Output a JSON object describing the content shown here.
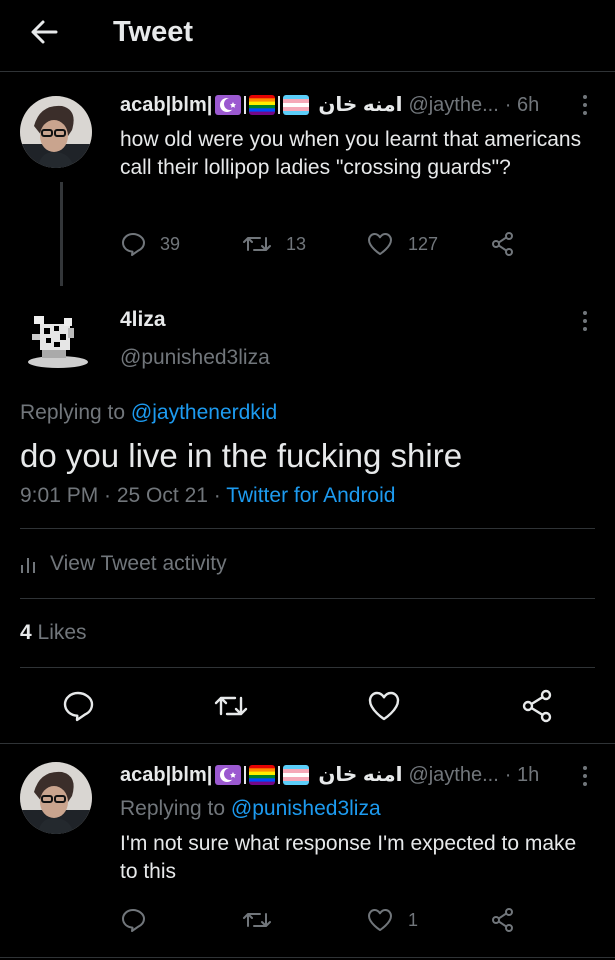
{
  "header": {
    "title": "Tweet"
  },
  "parent_tweet": {
    "display_name": "acab|blm|",
    "arabic_name": "امنه خان",
    "handle": "@jaythe...",
    "time": "· 6h",
    "text": "how old were you when you learnt that americans call their lollipop ladies \"crossing guards\"?",
    "replies": "39",
    "retweets": "13",
    "likes": "127"
  },
  "main_tweet": {
    "display_name": "4liza",
    "handle": "@punished3liza",
    "replying_prefix": "Replying to",
    "replying_to": "@jaythenerdkid",
    "text": "do you live in the fucking shire",
    "time": "9:01 PM · 25 Oct 21 · ",
    "source": "Twitter for Android",
    "activity_label": "View Tweet activity",
    "likes_count": "4",
    "likes_label": "Likes"
  },
  "reply_tweet": {
    "display_name": "acab|blm|",
    "arabic_name": "امنه خان",
    "handle": "@jaythe...",
    "time": "· 1h",
    "replying_prefix": "Replying to",
    "replying_to": "@punished3liza",
    "text": "I'm not sure what response I'm expected to make to this",
    "likes": "1"
  },
  "colors": {
    "background": "#000000",
    "text": "#e7e9ea",
    "secondary": "#71767b",
    "link": "#1d9bf0",
    "divider": "#2f3336"
  },
  "icons": [
    "back-arrow-icon",
    "reply-icon",
    "retweet-icon",
    "like-icon",
    "share-icon",
    "more-icon",
    "activity-icon",
    "moon-flag-icon",
    "rainbow-flag-icon",
    "trans-flag-icon"
  ]
}
